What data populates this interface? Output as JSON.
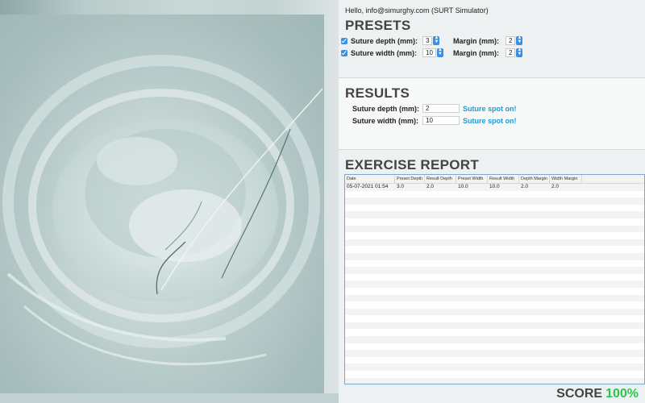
{
  "app": {
    "greeting": "Hello, info@simurghy.com (SURT Simulator)"
  },
  "presets": {
    "title": "PRESETS",
    "rows": [
      {
        "label": "Suture depth (mm):",
        "value": "3",
        "margin_label": "Margin (mm):",
        "margin_value": "2",
        "checked": true
      },
      {
        "label": "Suture width (mm):",
        "value": "10",
        "margin_label": "Margin (mm):",
        "margin_value": "2",
        "checked": true
      }
    ]
  },
  "results": {
    "title": "RESULTS",
    "rows": [
      {
        "label": "Suture depth (mm):",
        "value": "2",
        "status": "Suture spot on!"
      },
      {
        "label": "Suture width (mm):",
        "value": "10",
        "status": "Suture spot on!"
      }
    ]
  },
  "report": {
    "title": "EXERCISE REPORT",
    "columns": [
      "Date",
      "Preset Depth",
      "Result Depth",
      "Preset Width",
      "Result Width",
      "Depth Margin",
      "Width Margin",
      ""
    ],
    "rows": [
      [
        "05-07-2021 01:54",
        "3.0",
        "2.0",
        "10.0",
        "10.0",
        "2.0",
        "2.0",
        ""
      ]
    ],
    "empty_rows": 28
  },
  "score": {
    "label": "SCORE",
    "value": "100%"
  },
  "colors": {
    "accent": "#3b8ee0",
    "status": "#1f9bd6",
    "score": "#2fc44b"
  },
  "icons": {
    "checkbox": "checkbox-checked-icon",
    "stepper": "stepper-arrows-icon"
  }
}
